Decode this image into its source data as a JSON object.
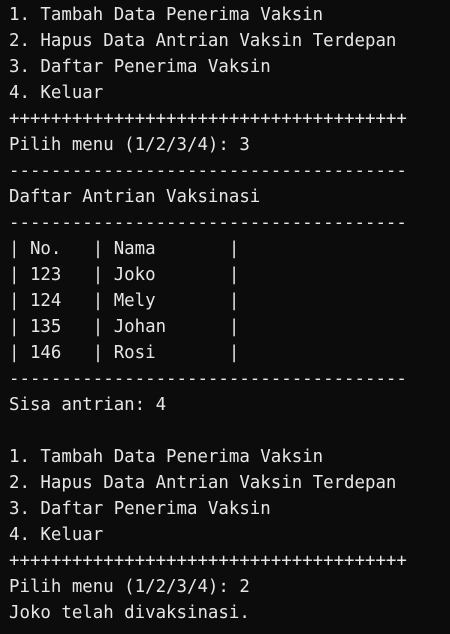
{
  "console": {
    "lines": [
      "1. Tambah Data Penerima Vaksin",
      "2. Hapus Data Antrian Vaksin Terdepan",
      "3. Daftar Penerima Vaksin",
      "4. Keluar",
      "++++++++++++++++++++++++++++++++++++++",
      "Pilih menu (1/2/3/4): 3",
      "--------------------------------------",
      "Daftar Antrian Vaksinasi",
      "--------------------------------------",
      "| No.   | Nama       |",
      "| 123   | Joko       |",
      "| 124   | Mely       |",
      "| 135   | Johan      |",
      "| 146   | Rosi       |",
      "--------------------------------------",
      "Sisa antrian: 4",
      "",
      "1. Tambah Data Penerima Vaksin",
      "2. Hapus Data Antrian Vaksin Terdepan",
      "3. Daftar Penerima Vaksin",
      "4. Keluar",
      "++++++++++++++++++++++++++++++++++++++",
      "Pilih menu (1/2/3/4): 2",
      "Joko telah divaksinasi."
    ]
  }
}
